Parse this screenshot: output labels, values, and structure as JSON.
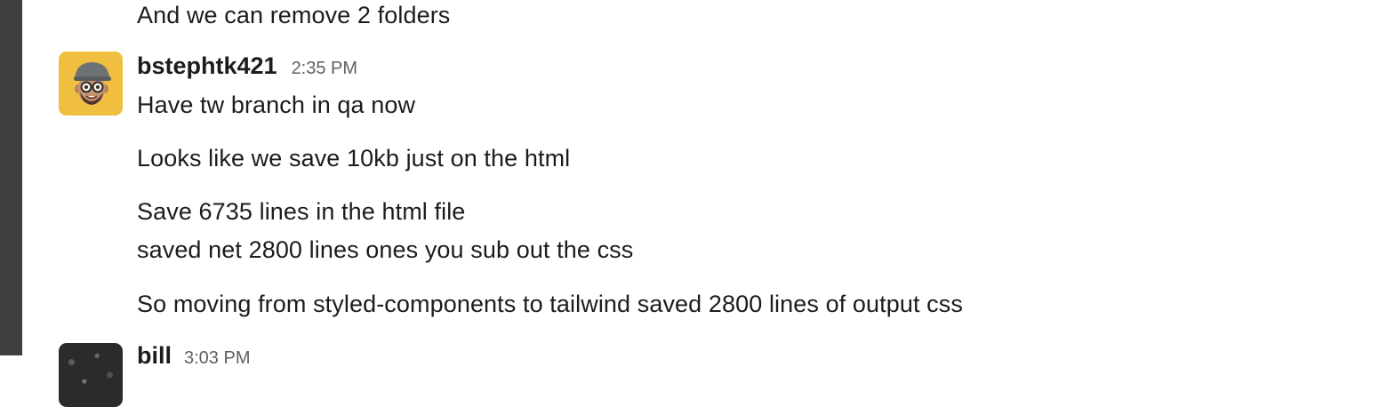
{
  "previous_message": {
    "text": "And we can remove 2 folders"
  },
  "message": {
    "username": "bstephtk421",
    "timestamp": "2:35 PM",
    "avatar": "memoji-avatar",
    "lines": [
      "Have tw branch in qa now",
      "Looks like we save 10kb just on the html",
      "Save 6735 lines in the html file",
      "saved net 2800 lines ones you sub out the css",
      "So moving from styled-components to tailwind saved  2800 lines of output css"
    ]
  },
  "next_message": {
    "username": "bill",
    "timestamp": "3:03 PM",
    "avatar": "photo-avatar"
  },
  "colors": {
    "left_rail": "#3f3f40",
    "avatar_bg": "#f0bf3f",
    "text": "#1d1c1d",
    "timestamp": "#616061"
  }
}
